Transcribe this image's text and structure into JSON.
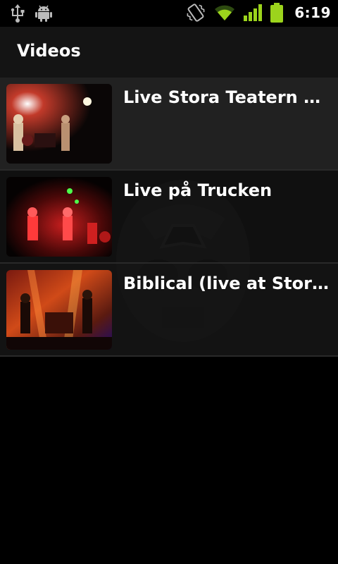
{
  "status_bar": {
    "time": "6:19",
    "left_icons": [
      "usb-icon",
      "android-debug-icon"
    ],
    "right_icons": [
      "vibrate-icon",
      "wifi-icon",
      "signal-icon",
      "battery-icon"
    ]
  },
  "screen": {
    "title": "Videos"
  },
  "videos": [
    {
      "title": "Live Stora Teatern Göteborg"
    },
    {
      "title": "Live på Trucken"
    },
    {
      "title": "Biblical (live at Stora Teatern)"
    }
  ],
  "colors": {
    "status_green": "#9cd41c",
    "background": "#000000",
    "row_bg": "#242424"
  }
}
